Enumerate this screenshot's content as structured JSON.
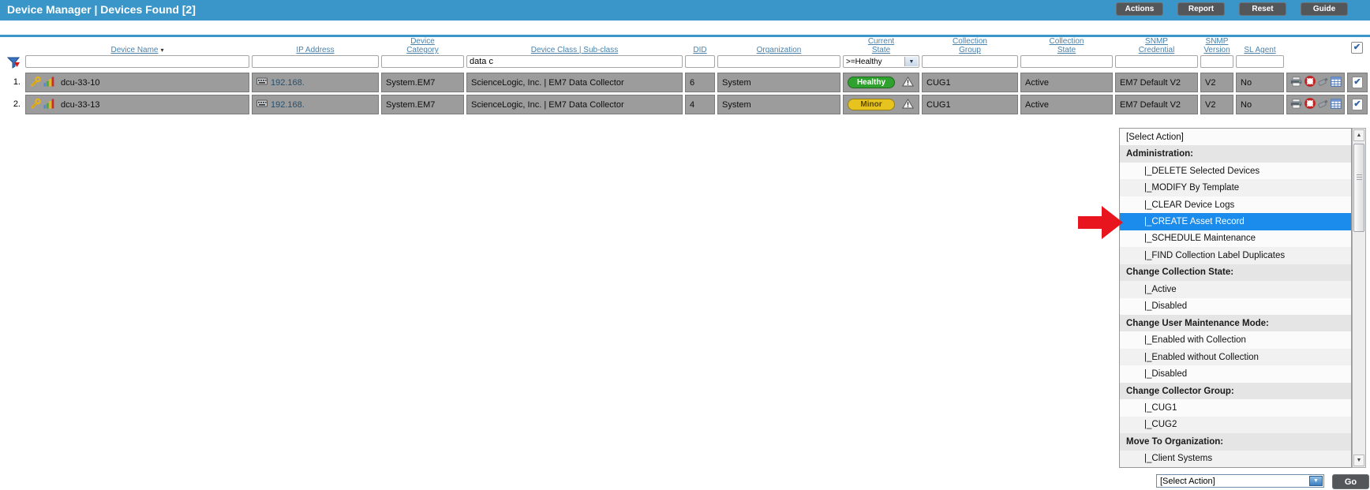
{
  "title_bar": {
    "title": "Device Manager | Devices Found [2]",
    "buttons": [
      {
        "label": "Actions"
      },
      {
        "label": "Report"
      },
      {
        "label": "Reset"
      },
      {
        "label": "Guide"
      }
    ]
  },
  "table": {
    "sort_indicator": "▾",
    "columns": [
      {
        "id": "device_name",
        "lines": [
          "Device Name"
        ],
        "sorted": true
      },
      {
        "id": "ip_address",
        "lines": [
          "IP Address"
        ]
      },
      {
        "id": "device_category",
        "lines": [
          "Device",
          "Category"
        ]
      },
      {
        "id": "device_class",
        "lines": [
          "Device Class | Sub-class"
        ]
      },
      {
        "id": "did",
        "lines": [
          "DID"
        ]
      },
      {
        "id": "organization",
        "lines": [
          "Organization"
        ]
      },
      {
        "id": "current_state",
        "lines": [
          "Current",
          "State"
        ]
      },
      {
        "id": "collection_group",
        "lines": [
          "Collection",
          "Group"
        ]
      },
      {
        "id": "collection_state",
        "lines": [
          "Collection",
          "State"
        ]
      },
      {
        "id": "snmp_credential",
        "lines": [
          "SNMP",
          "Credential"
        ]
      },
      {
        "id": "snmp_version",
        "lines": [
          "SNMP",
          "Version"
        ]
      },
      {
        "id": "sl_agent",
        "lines": [
          "SL Agent"
        ]
      }
    ],
    "filters": {
      "device_name": "",
      "ip_address": "",
      "device_category": "",
      "device_class": "data c",
      "did": "",
      "organization": "",
      "current_state": ">=Healthy",
      "collection_group": "",
      "collection_state": "",
      "snmp_credential": "",
      "snmp_version": "",
      "sl_agent": ""
    },
    "rows": [
      {
        "num": "1.",
        "device_name": "dcu-33-10",
        "ip_address": "192.168.",
        "device_category": "System.EM7",
        "device_class": "ScienceLogic, Inc. | EM7 Data Collector",
        "did": "6",
        "organization": "System",
        "current_state": "Healthy",
        "state_bg": "#2FA12F",
        "state_fg": "#FFFFFF",
        "collection_group": "CUG1",
        "collection_state": "Active",
        "snmp_credential": "EM7 Default V2",
        "snmp_version": "V2",
        "sl_agent": "No",
        "checkbox_glyph": "✔"
      },
      {
        "num": "2.",
        "device_name": "dcu-33-13",
        "ip_address": "192.168.",
        "device_category": "System.EM7",
        "device_class": "ScienceLogic, Inc. | EM7 Data Collector",
        "did": "4",
        "organization": "System",
        "current_state": "Minor",
        "state_bg": "#E7C31F",
        "state_fg": "#5C4A00",
        "collection_group": "CUG1",
        "collection_state": "Active",
        "snmp_credential": "EM7 Default V2",
        "snmp_version": "V2",
        "sl_agent": "No",
        "checkbox_glyph": "✔"
      }
    ]
  },
  "action_menu": {
    "selected_color": "#1B8CEB",
    "items": [
      {
        "label": "[Select Action]",
        "type": "item",
        "indent": false
      },
      {
        "label": "Administration:",
        "type": "header"
      },
      {
        "label": "|_DELETE Selected Devices",
        "type": "item",
        "indent": true
      },
      {
        "label": "|_MODIFY By Template",
        "type": "item",
        "indent": true
      },
      {
        "label": "|_CLEAR Device Logs",
        "type": "item",
        "indent": true
      },
      {
        "label": "|_CREATE Asset Record",
        "type": "item",
        "indent": true,
        "selected": true
      },
      {
        "label": "|_SCHEDULE Maintenance",
        "type": "item",
        "indent": true
      },
      {
        "label": "|_FIND Collection Label Duplicates",
        "type": "item",
        "indent": true
      },
      {
        "label": "Change Collection State:",
        "type": "header"
      },
      {
        "label": "|_Active",
        "type": "item",
        "indent": true
      },
      {
        "label": "|_Disabled",
        "type": "item",
        "indent": true
      },
      {
        "label": "Change User Maintenance Mode:",
        "type": "header"
      },
      {
        "label": "|_Enabled with Collection",
        "type": "item",
        "indent": true
      },
      {
        "label": "|_Enabled without Collection",
        "type": "item",
        "indent": true
      },
      {
        "label": "|_Disabled",
        "type": "item",
        "indent": true
      },
      {
        "label": "Change Collector Group:",
        "type": "header"
      },
      {
        "label": "|_CUG1",
        "type": "item",
        "indent": true
      },
      {
        "label": "|_CUG2",
        "type": "item",
        "indent": true
      },
      {
        "label": "Move To Organization:",
        "type": "header"
      },
      {
        "label": "|_Client Systems",
        "type": "item",
        "indent": true
      }
    ]
  },
  "footer": {
    "select_value": "[Select Action]",
    "go_label": "Go"
  }
}
